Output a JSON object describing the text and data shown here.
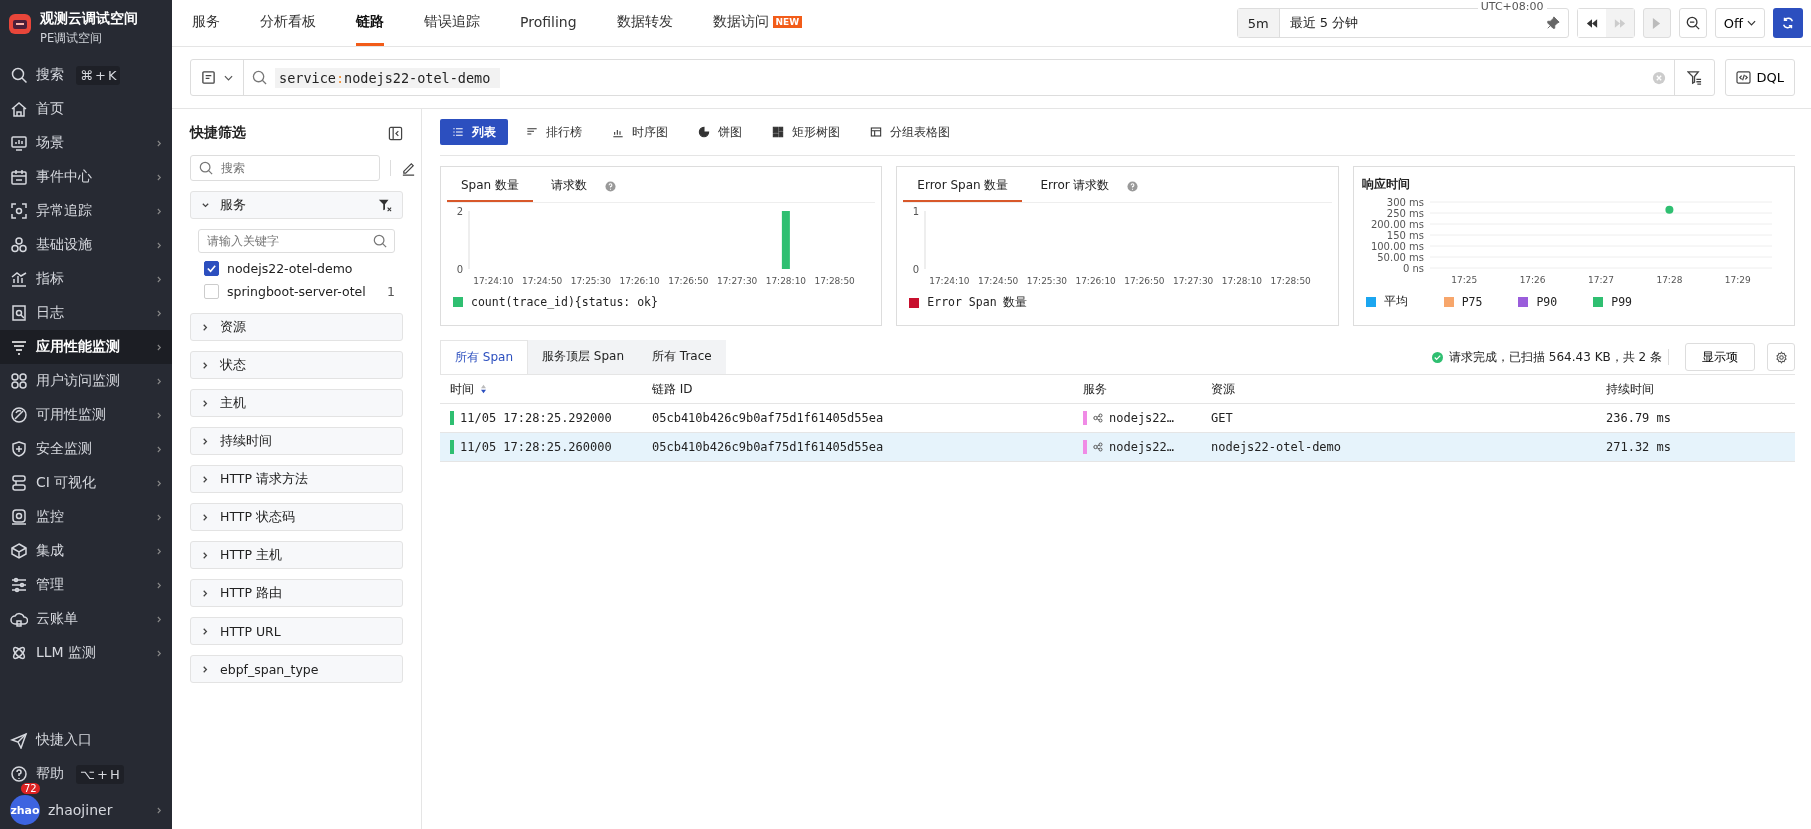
{
  "sidebar": {
    "workspace": {
      "title": "观测云调试空间",
      "subtitle": "PE调试空间"
    },
    "items": [
      {
        "label": "搜索",
        "shortcut": [
          "⌘",
          "+",
          "K"
        ],
        "has_arrow": false,
        "selected": false
      },
      {
        "label": "首页",
        "has_arrow": false,
        "selected": false
      },
      {
        "label": "场景",
        "has_arrow": true,
        "selected": false
      },
      {
        "label": "事件中心",
        "has_arrow": true,
        "selected": false
      },
      {
        "label": "异常追踪",
        "has_arrow": true,
        "selected": false
      },
      {
        "label": "基础设施",
        "has_arrow": true,
        "selected": false
      },
      {
        "label": "指标",
        "has_arrow": true,
        "selected": false
      },
      {
        "label": "日志",
        "has_arrow": true,
        "selected": false
      },
      {
        "label": "应用性能监测",
        "has_arrow": true,
        "selected": true
      },
      {
        "label": "用户访问监测",
        "has_arrow": true,
        "selected": false
      },
      {
        "label": "可用性监测",
        "has_arrow": true,
        "selected": false
      },
      {
        "label": "安全监测",
        "has_arrow": true,
        "selected": false
      },
      {
        "label": "CI 可视化",
        "has_arrow": true,
        "selected": false
      },
      {
        "label": "监控",
        "has_arrow": true,
        "selected": false
      },
      {
        "label": "集成",
        "has_arrow": true,
        "selected": false
      },
      {
        "label": "管理",
        "has_arrow": true,
        "selected": false
      },
      {
        "label": "云账单",
        "has_arrow": true,
        "selected": false
      },
      {
        "label": "LLM 监测",
        "has_arrow": true,
        "selected": false
      }
    ],
    "bottom_items": [
      {
        "label": "快捷入口"
      },
      {
        "label": "帮助",
        "shortcut": [
          "⌥",
          "+",
          "H"
        ]
      }
    ],
    "user": {
      "avatar_text": "zhao",
      "badge": "72",
      "name": "zhaojiner"
    }
  },
  "top_tabs": [
    {
      "label": "服务",
      "selected": false
    },
    {
      "label": "分析看板",
      "selected": false
    },
    {
      "label": "链路",
      "selected": true
    },
    {
      "label": "错误追踪",
      "selected": false
    },
    {
      "label": "Profiling",
      "selected": false
    },
    {
      "label": "数据转发",
      "selected": false
    },
    {
      "label": "数据访问",
      "selected": false,
      "badge": "NEW"
    }
  ],
  "time_controls": {
    "quick": "5m",
    "range": "最近 5 分钟",
    "timezone": "UTC+08:00",
    "refresh": "Off"
  },
  "search": {
    "key": "service",
    "separator": ":",
    "value": "nodejs22-otel-demo"
  },
  "dql_button": "DQL",
  "filters": {
    "title": "快捷筛选",
    "search_placeholder": "搜索",
    "groups": [
      {
        "label": "服务",
        "expanded": true,
        "keyword_placeholder": "请输入关键字",
        "options": [
          {
            "label": "nodejs22-otel-demo",
            "checked": true
          },
          {
            "label": "springboot-server-otel",
            "checked": false,
            "count": "1"
          }
        ]
      },
      {
        "label": "资源",
        "expanded": false
      },
      {
        "label": "状态",
        "expanded": false
      },
      {
        "label": "主机",
        "expanded": false
      },
      {
        "label": "持续时间",
        "expanded": false
      },
      {
        "label": "HTTP 请求方法",
        "expanded": false
      },
      {
        "label": "HTTP 状态码",
        "expanded": false
      },
      {
        "label": "HTTP 主机",
        "expanded": false
      },
      {
        "label": "HTTP 路由",
        "expanded": false
      },
      {
        "label": "HTTP URL",
        "expanded": false
      },
      {
        "label": "ebpf_span_type",
        "expanded": false
      }
    ]
  },
  "views": [
    {
      "label": "列表",
      "selected": true
    },
    {
      "label": "排行榜",
      "selected": false
    },
    {
      "label": "时序图",
      "selected": false
    },
    {
      "label": "饼图",
      "selected": false
    },
    {
      "label": "矩形树图",
      "selected": false
    },
    {
      "label": "分组表格图",
      "selected": false
    }
  ],
  "panels": [
    {
      "tabs": [
        {
          "label": "Span 数量",
          "selected": true
        },
        {
          "label": "请求数",
          "selected": false
        }
      ],
      "chart_data": {
        "type": "bar",
        "categories": [
          "17:24:10",
          "17:24:50",
          "17:25:30",
          "17:26:10",
          "17:26:50",
          "17:27:30",
          "17:28:10",
          "17:28:50"
        ],
        "series": [
          {
            "name": "count(trace_id){status: ok}",
            "color": "#2fbf71",
            "values": [
              0,
              0,
              0,
              0,
              0,
              0,
              2,
              0
            ]
          }
        ],
        "ylim": [
          0,
          2
        ],
        "yticks": [
          0,
          2
        ]
      }
    },
    {
      "tabs": [
        {
          "label": "Error Span 数量",
          "selected": true
        },
        {
          "label": "Error 请求数",
          "selected": false
        }
      ],
      "chart_data": {
        "type": "bar",
        "categories": [
          "17:24:10",
          "17:24:50",
          "17:25:30",
          "17:26:10",
          "17:26:50",
          "17:27:30",
          "17:28:10",
          "17:28:50"
        ],
        "series": [
          {
            "name": "Error Span 数量",
            "color": "#c8102e",
            "values": [
              0,
              0,
              0,
              0,
              0,
              0,
              0,
              0
            ]
          }
        ],
        "ylim": [
          0,
          1
        ],
        "yticks": [
          0,
          1
        ]
      }
    },
    {
      "title": "响应时间",
      "chart_data": {
        "type": "scatter",
        "categories": [
          "17:25",
          "17:26",
          "17:27",
          "17:28",
          "17:29"
        ],
        "series": [
          {
            "name": "平均",
            "color": "#1ba6f0",
            "values": [
              null,
              null,
              null,
              null,
              null
            ]
          },
          {
            "name": "P75",
            "color": "#f7a66b",
            "values": [
              null,
              null,
              null,
              null,
              null
            ]
          },
          {
            "name": "P90",
            "color": "#9a5ddb",
            "values": [
              null,
              null,
              null,
              null,
              null
            ]
          },
          {
            "name": "P99",
            "color": "#2fbf71",
            "values": [
              null,
              null,
              null,
              265,
              null
            ]
          }
        ],
        "ylim": [
          0,
          300
        ],
        "grid": true,
        "yticks": [
          {
            "value": 0,
            "label": "0 ns"
          },
          {
            "value": 50,
            "label": "50.00 ms"
          },
          {
            "value": 100,
            "label": "100.00 ms"
          },
          {
            "value": 150,
            "label": "150 ms"
          },
          {
            "value": 200,
            "label": "200.00 ms"
          },
          {
            "value": 250,
            "label": "250 ms"
          },
          {
            "value": 300,
            "label": "300 ms"
          }
        ]
      }
    }
  ],
  "table": {
    "tabs": [
      {
        "label": "所有 Span",
        "selected": true
      },
      {
        "label": "服务顶层 Span",
        "selected": false
      },
      {
        "label": "所有 Trace",
        "selected": false
      }
    ],
    "status": "请求完成，已扫描 564.43 KB，共 2 条",
    "display_button": "显示项",
    "columns": [
      {
        "label": "时间",
        "sorted": true
      },
      {
        "label": "链路 ID",
        "sorted": false
      },
      {
        "label": "服务",
        "sorted": false
      },
      {
        "label": "资源",
        "sorted": false
      },
      {
        "label": "持续时间",
        "sorted": false
      }
    ],
    "rows": [
      {
        "time": "11/05 17:28:25.292000",
        "trace_id": "05cb410b426c9b0af75d1f61405d55ea",
        "service": "nodejs22…",
        "resource": "GET",
        "duration": "236.79 ms",
        "color": "#2fbf71",
        "selected": false
      },
      {
        "time": "11/05 17:28:25.260000",
        "trace_id": "05cb410b426c9b0af75d1f61405d55ea",
        "service": "nodejs22…",
        "resource": "nodejs22-otel-demo",
        "duration": "271.32 ms",
        "color": "#2fbf71",
        "selected": true
      }
    ]
  }
}
